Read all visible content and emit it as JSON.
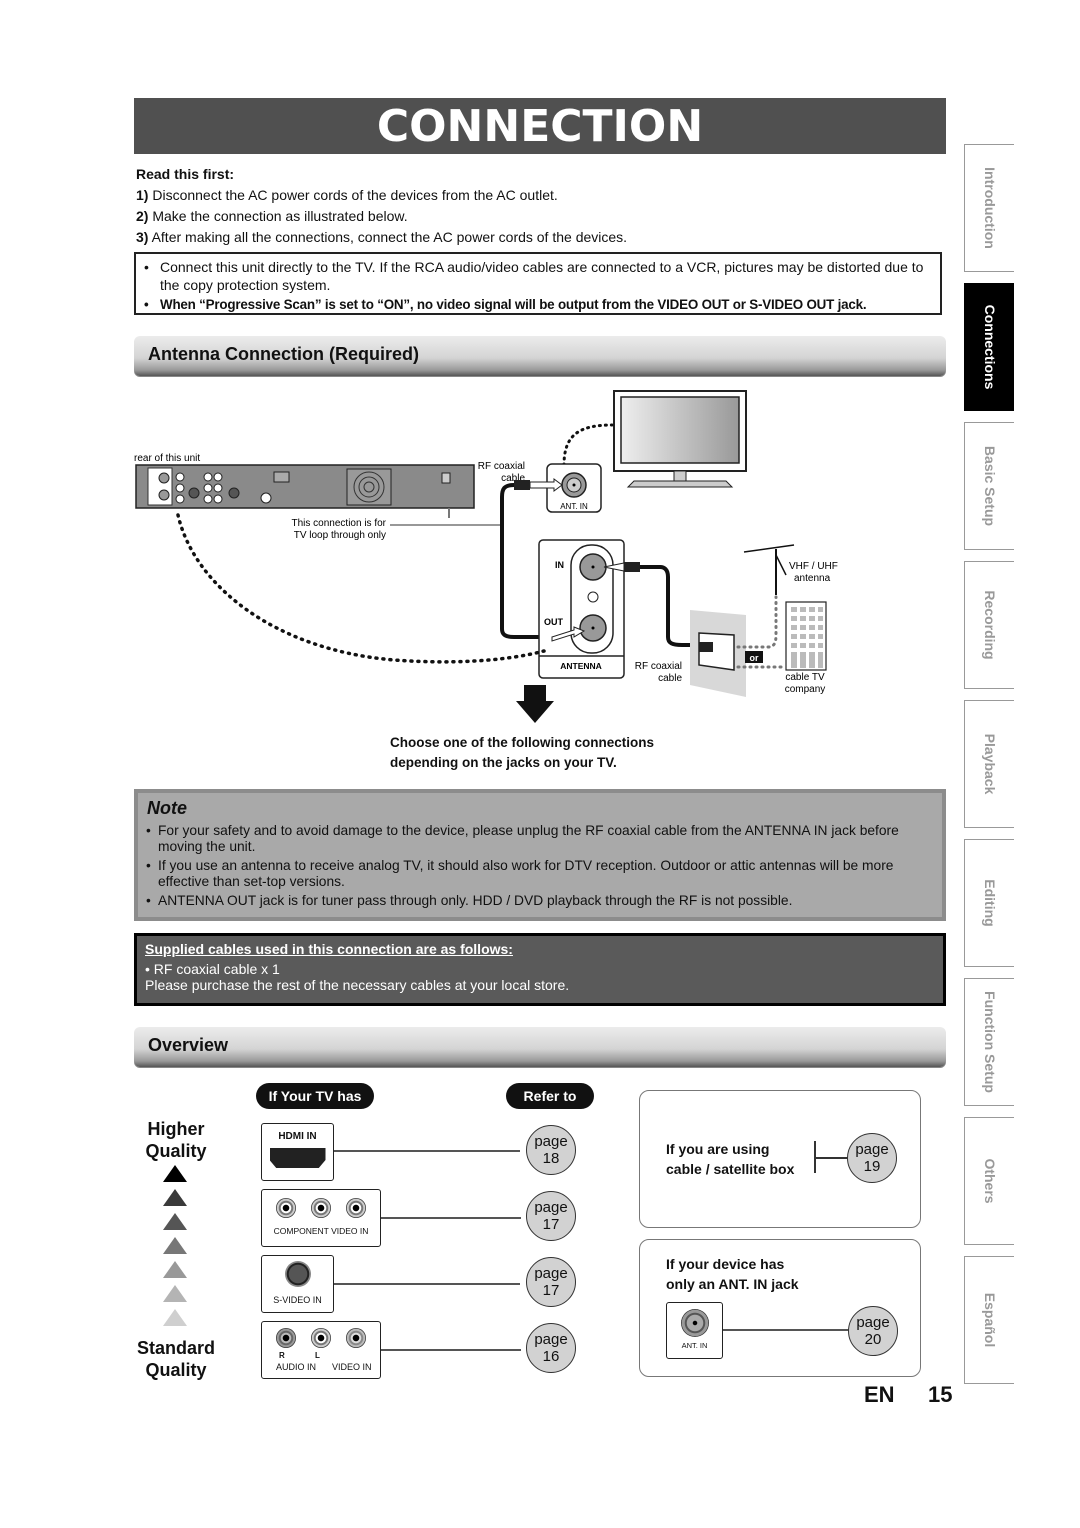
{
  "title": "CONNECTION",
  "read_first": {
    "heading": "Read this first:",
    "steps": [
      {
        "num": "1)",
        "text": " Disconnect the AC power cords of the devices from the AC outlet."
      },
      {
        "num": "2)",
        "text": " Make the connection as illustrated below."
      },
      {
        "num": "3)",
        "text": " After making all the connections, connect the AC power cords of the devices."
      }
    ]
  },
  "warnings": [
    "Connect this unit directly to the TV. If the RCA audio/video cables are connected to a VCR, pictures may be distorted due to the copy protection system.",
    "When “Progressive Scan” is set to “ON”, no video signal will be output from the VIDEO OUT or S-VIDEO OUT jack."
  ],
  "antenna_section": {
    "heading": "Antenna Connection (Required)",
    "diagram": {
      "rear_label": "rear of this unit",
      "rf_cable_label_1": "RF coaxial",
      "rf_cable_label_2": "cable",
      "loop_label_1": "This connection is for",
      "loop_label_2": "TV loop through only",
      "ant_in": "ANT. IN",
      "in": "IN",
      "out": "OUT",
      "antenna": "ANTENNA",
      "vhf_1": "VHF / UHF",
      "vhf_2": "antenna",
      "or": "or",
      "cable_tv_1": "cable TV",
      "cable_tv_2": "company"
    },
    "choose_line_1": "Choose one of the following connections",
    "choose_line_2": "depending on the jacks on your TV."
  },
  "note": {
    "title": "Note",
    "items": [
      "For your safety and to avoid damage to the device, please unplug the RF coaxial cable from the ANTENNA IN jack before moving the unit.",
      "If you use an antenna to receive analog TV, it should also work for DTV reception. Outdoor or attic antennas will be more effective than set-top versions.",
      "ANTENNA OUT jack is for tuner pass through only. HDD / DVD playback through the RF is not possible."
    ]
  },
  "supplied": {
    "heading": "Supplied cables used in this connection are as follows:",
    "item": "• RF coaxial cable x 1",
    "note": "Please purchase the rest of the necessary cables at your local store."
  },
  "overview": {
    "heading": "Overview",
    "if_tv_has": "If Your TV has",
    "refer_to": "Refer to",
    "higher_1": "Higher",
    "higher_2": "Quality",
    "standard_1": "Standard",
    "standard_2": "Quality",
    "rows": [
      {
        "jack": "HDMI IN",
        "page_word": "page",
        "page": "18"
      },
      {
        "jack": "COMPONENT VIDEO IN",
        "page_word": "page",
        "page": "17"
      },
      {
        "jack": "S-VIDEO IN",
        "page_word": "page",
        "page": "17"
      },
      {
        "jack_r": "R",
        "jack_l": "L",
        "jack_audio": "AUDIO IN",
        "jack_video": "VIDEO IN",
        "page_word": "page",
        "page": "16"
      }
    ],
    "cable_box": {
      "line1": "If you are using",
      "line2": "cable / satellite box",
      "page_word": "page",
      "page": "19"
    },
    "ant_only": {
      "line1": "If your device has",
      "line2": "only an ANT. IN jack",
      "jack": "ANT. IN",
      "page_word": "page",
      "page": "20"
    }
  },
  "side_tabs": [
    {
      "label": "Introduction",
      "active": false
    },
    {
      "label": "Connections",
      "active": true
    },
    {
      "label": "Basic Setup",
      "active": false
    },
    {
      "label": "Recording",
      "active": false
    },
    {
      "label": "Playback",
      "active": false
    },
    {
      "label": "Editing",
      "active": false
    },
    {
      "label": "Function Setup",
      "active": false
    },
    {
      "label": "Others",
      "active": false
    },
    {
      "label": "Español",
      "active": false
    }
  ],
  "footer": {
    "lang": "EN",
    "page": "15"
  }
}
